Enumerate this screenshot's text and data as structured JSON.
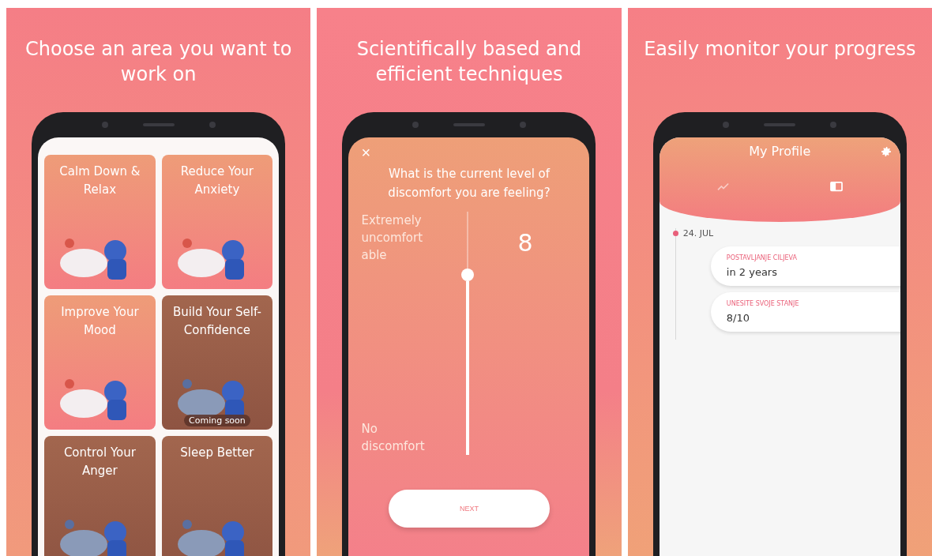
{
  "panels": [
    {
      "kind": "areas",
      "headline": "Choose an area you want to work on",
      "areas": [
        {
          "title": "Calm Down & Relax",
          "locked": false
        },
        {
          "title": "Reduce Your Anxiety",
          "locked": false
        },
        {
          "title": "Improve Your Mood",
          "locked": false
        },
        {
          "title": "Build Your Self-Confidence",
          "locked": true,
          "badge": "Coming soon"
        },
        {
          "title": "Control Your Anger",
          "locked": true
        },
        {
          "title": "Sleep Better",
          "locked": true
        }
      ]
    },
    {
      "kind": "question",
      "headline": "Scientifically based and efficient techniques",
      "close": "×",
      "question": "What is the current level of discomfort you are feeling?",
      "top_label": "Extremely uncomfortable",
      "bottom_label": "No discomfort",
      "value": "8",
      "level": 0.74,
      "button": "NEXT"
    },
    {
      "kind": "profile",
      "headline": "Easily monitor your progress",
      "title": "My Profile",
      "tabs": [
        {
          "kind": "chart",
          "selected": false
        },
        {
          "kind": "journal",
          "selected": true
        }
      ],
      "date": "24. JUL",
      "entries": [
        {
          "label": "POSTAVLJANJE CILJEVA",
          "value": "in 2 years"
        },
        {
          "label": "UNESITE SVOJE STANJE",
          "value": "8/10"
        }
      ]
    }
  ]
}
